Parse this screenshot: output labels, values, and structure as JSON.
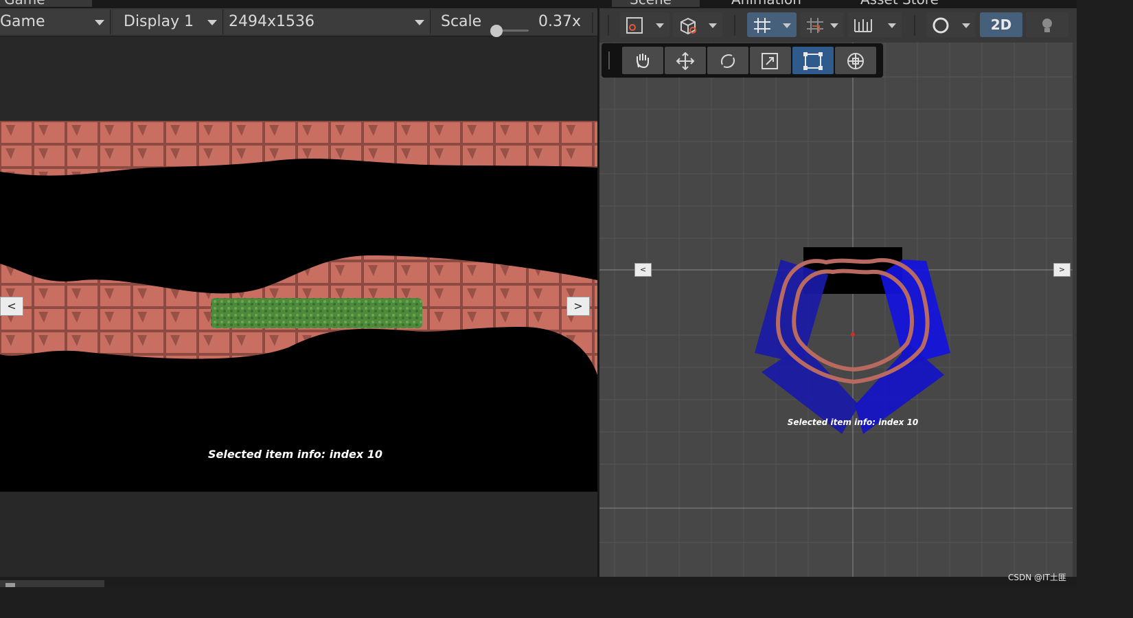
{
  "game": {
    "tab_label": "Game",
    "mode": "Game",
    "display": "Display 1",
    "resolution": "2494x1536",
    "scale_label": "Scale",
    "scale_value": "0.37x",
    "prev_label": "<",
    "next_label": ">",
    "info_text": "Selected item info: index 10"
  },
  "scene": {
    "tabs": [
      "Scene",
      "Animation",
      "Asset Store"
    ],
    "mode_2d_label": "2D",
    "prev_label": "<",
    "next_label": ">",
    "info_text": "Selected item info: index 10"
  },
  "watermark": "CSDN @IT土匪",
  "colors": {
    "brick": "#c96f62",
    "grass": "#4f8a3c",
    "scene_blue": "#1a1aa8",
    "scene_background": "#474747",
    "game_background": "#000000",
    "toolbar": "#383838",
    "active_tool": "#2e5a8c"
  }
}
